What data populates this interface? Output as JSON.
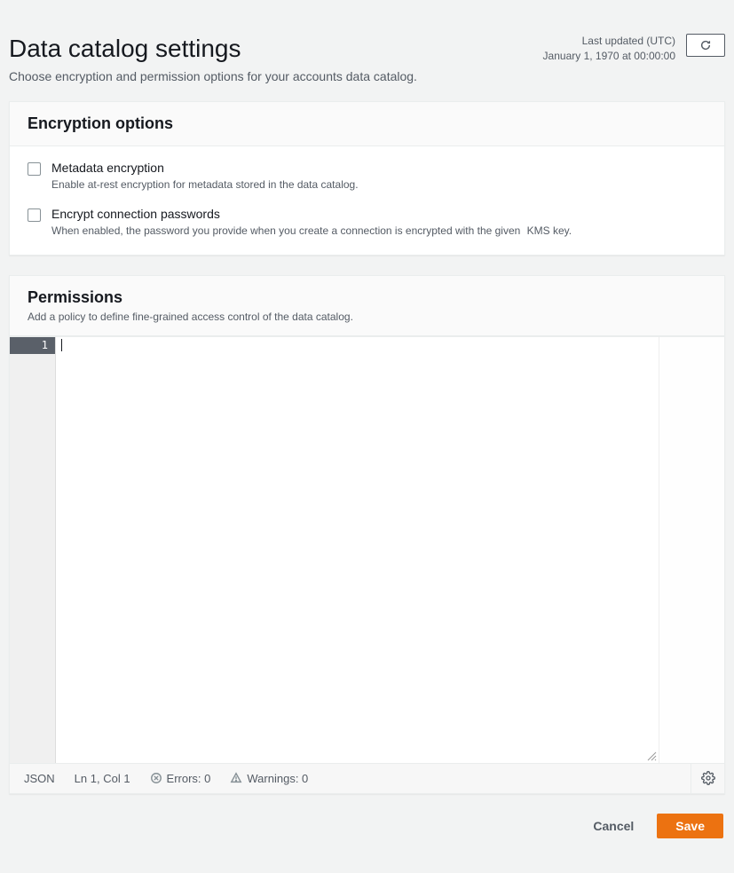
{
  "header": {
    "title": "Data catalog settings",
    "subtitle": "Choose encryption and permission options for your accounts data catalog.",
    "last_updated_label": "Last updated (UTC)",
    "last_updated_value": "January 1, 1970 at 00:00:00"
  },
  "encryption": {
    "panel_title": "Encryption options",
    "options": [
      {
        "title": "Metadata encryption",
        "desc": "Enable at-rest encryption for metadata stored in the data catalog."
      },
      {
        "title": "Encrypt connection passwords",
        "desc": "When enabled, the password you provide when you create a connection is encrypted with the given",
        "link": "KMS key."
      }
    ]
  },
  "permissions": {
    "panel_title": "Permissions",
    "panel_desc": "Add a policy to define fine-grained access control of the data catalog.",
    "gutter_line": "1",
    "status": {
      "lang": "JSON",
      "pos": "Ln 1, Col 1",
      "errors": "Errors: 0",
      "warnings": "Warnings: 0"
    }
  },
  "footer": {
    "cancel": "Cancel",
    "save": "Save"
  }
}
